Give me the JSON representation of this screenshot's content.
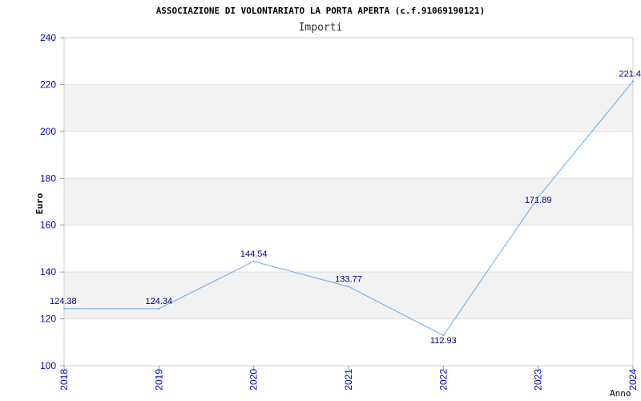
{
  "chart_data": {
    "type": "line",
    "title": "ASSOCIAZIONE DI VOLONTARIATO LA PORTA APERTA (c.f.91069190121)",
    "subtitle": "Importi",
    "xlabel": "Anno",
    "ylabel": "Euro",
    "ylim": [
      100,
      240
    ],
    "yticks": [
      100,
      120,
      140,
      160,
      180,
      200,
      220,
      240
    ],
    "grid": true,
    "x": [
      "2018",
      "2019",
      "2020",
      "2021",
      "2022",
      "2023",
      "2024"
    ],
    "series": [
      {
        "values": [
          124.38,
          124.34,
          144.54,
          133.77,
          112.93,
          171.89,
          221.4
        ],
        "labels": [
          "124.38",
          "124.34",
          "144.54",
          "133.77",
          "112.93",
          "171.89",
          "221.4"
        ]
      }
    ],
    "colors": {
      "line": "#66aaee",
      "tick_text": "#0000cc",
      "data_label": "#000080",
      "band": "#f2f2f2",
      "grid": "#dddddd"
    }
  }
}
